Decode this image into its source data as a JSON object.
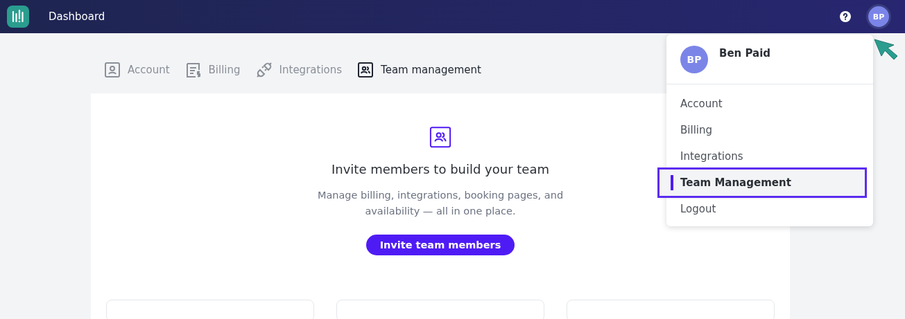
{
  "header": {
    "title": "Dashboard",
    "avatar": "BP"
  },
  "tabs": [
    {
      "label": "Account",
      "selected": false
    },
    {
      "label": "Billing",
      "selected": false
    },
    {
      "label": "Integrations",
      "selected": false
    },
    {
      "label": "Team management",
      "selected": true
    }
  ],
  "empty_state": {
    "heading": "Invite members to build your team",
    "text": "Manage billing, integrations, booking pages, and availability — all in one place.",
    "button": "Invite team members"
  },
  "menu": {
    "user": {
      "name": "Ben Paid",
      "initials": "BP"
    },
    "items": [
      {
        "label": "Account",
        "selected": false
      },
      {
        "label": "Billing",
        "selected": false
      },
      {
        "label": "Integrations",
        "selected": false
      },
      {
        "label": "Team Management",
        "selected": true
      },
      {
        "label": "Logout",
        "selected": false
      }
    ]
  }
}
